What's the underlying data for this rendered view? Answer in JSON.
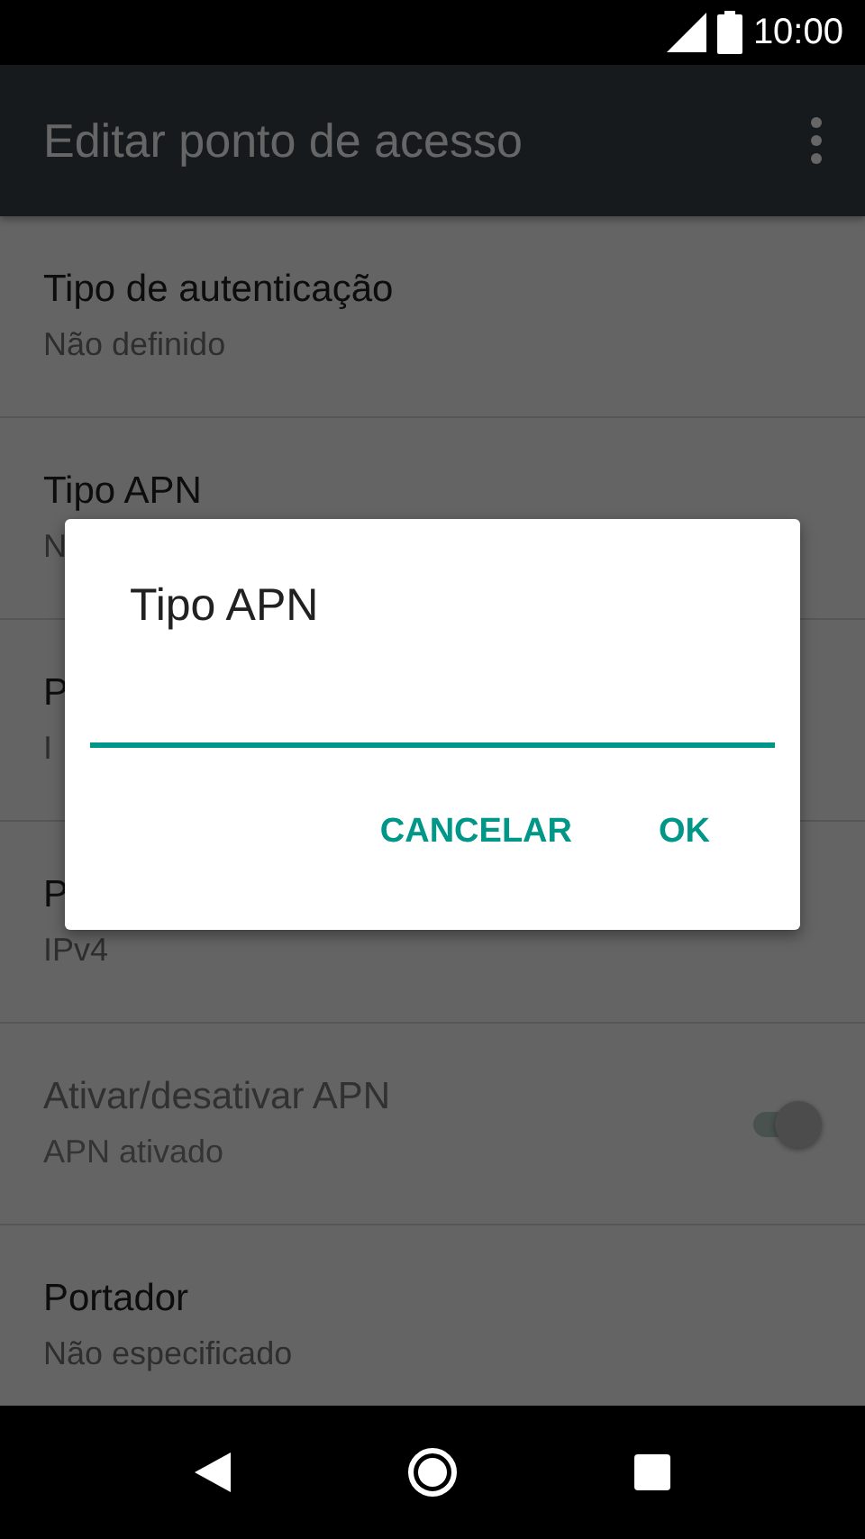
{
  "status_bar": {
    "time": "10:00"
  },
  "app_bar": {
    "title": "Editar ponto de acesso"
  },
  "settings": [
    {
      "kind": "text",
      "title": "Tipo de autenticação",
      "summary": "Não definido",
      "disabled": false
    },
    {
      "kind": "text",
      "title": "Tipo APN",
      "summary": "N",
      "disabled": false
    },
    {
      "kind": "text",
      "title": "P",
      "summary": "I",
      "disabled": false
    },
    {
      "kind": "text",
      "title": "P",
      "summary": "IPv4",
      "disabled": false
    },
    {
      "kind": "switch",
      "title": "Ativar/desativar APN",
      "summary": "APN ativado",
      "disabled": true,
      "on": true
    },
    {
      "kind": "text",
      "title": "Portador",
      "summary": "Não especificado",
      "disabled": false
    }
  ],
  "dialog": {
    "title": "Tipo APN",
    "buttons": [
      "CANCELAR",
      "OK"
    ]
  }
}
